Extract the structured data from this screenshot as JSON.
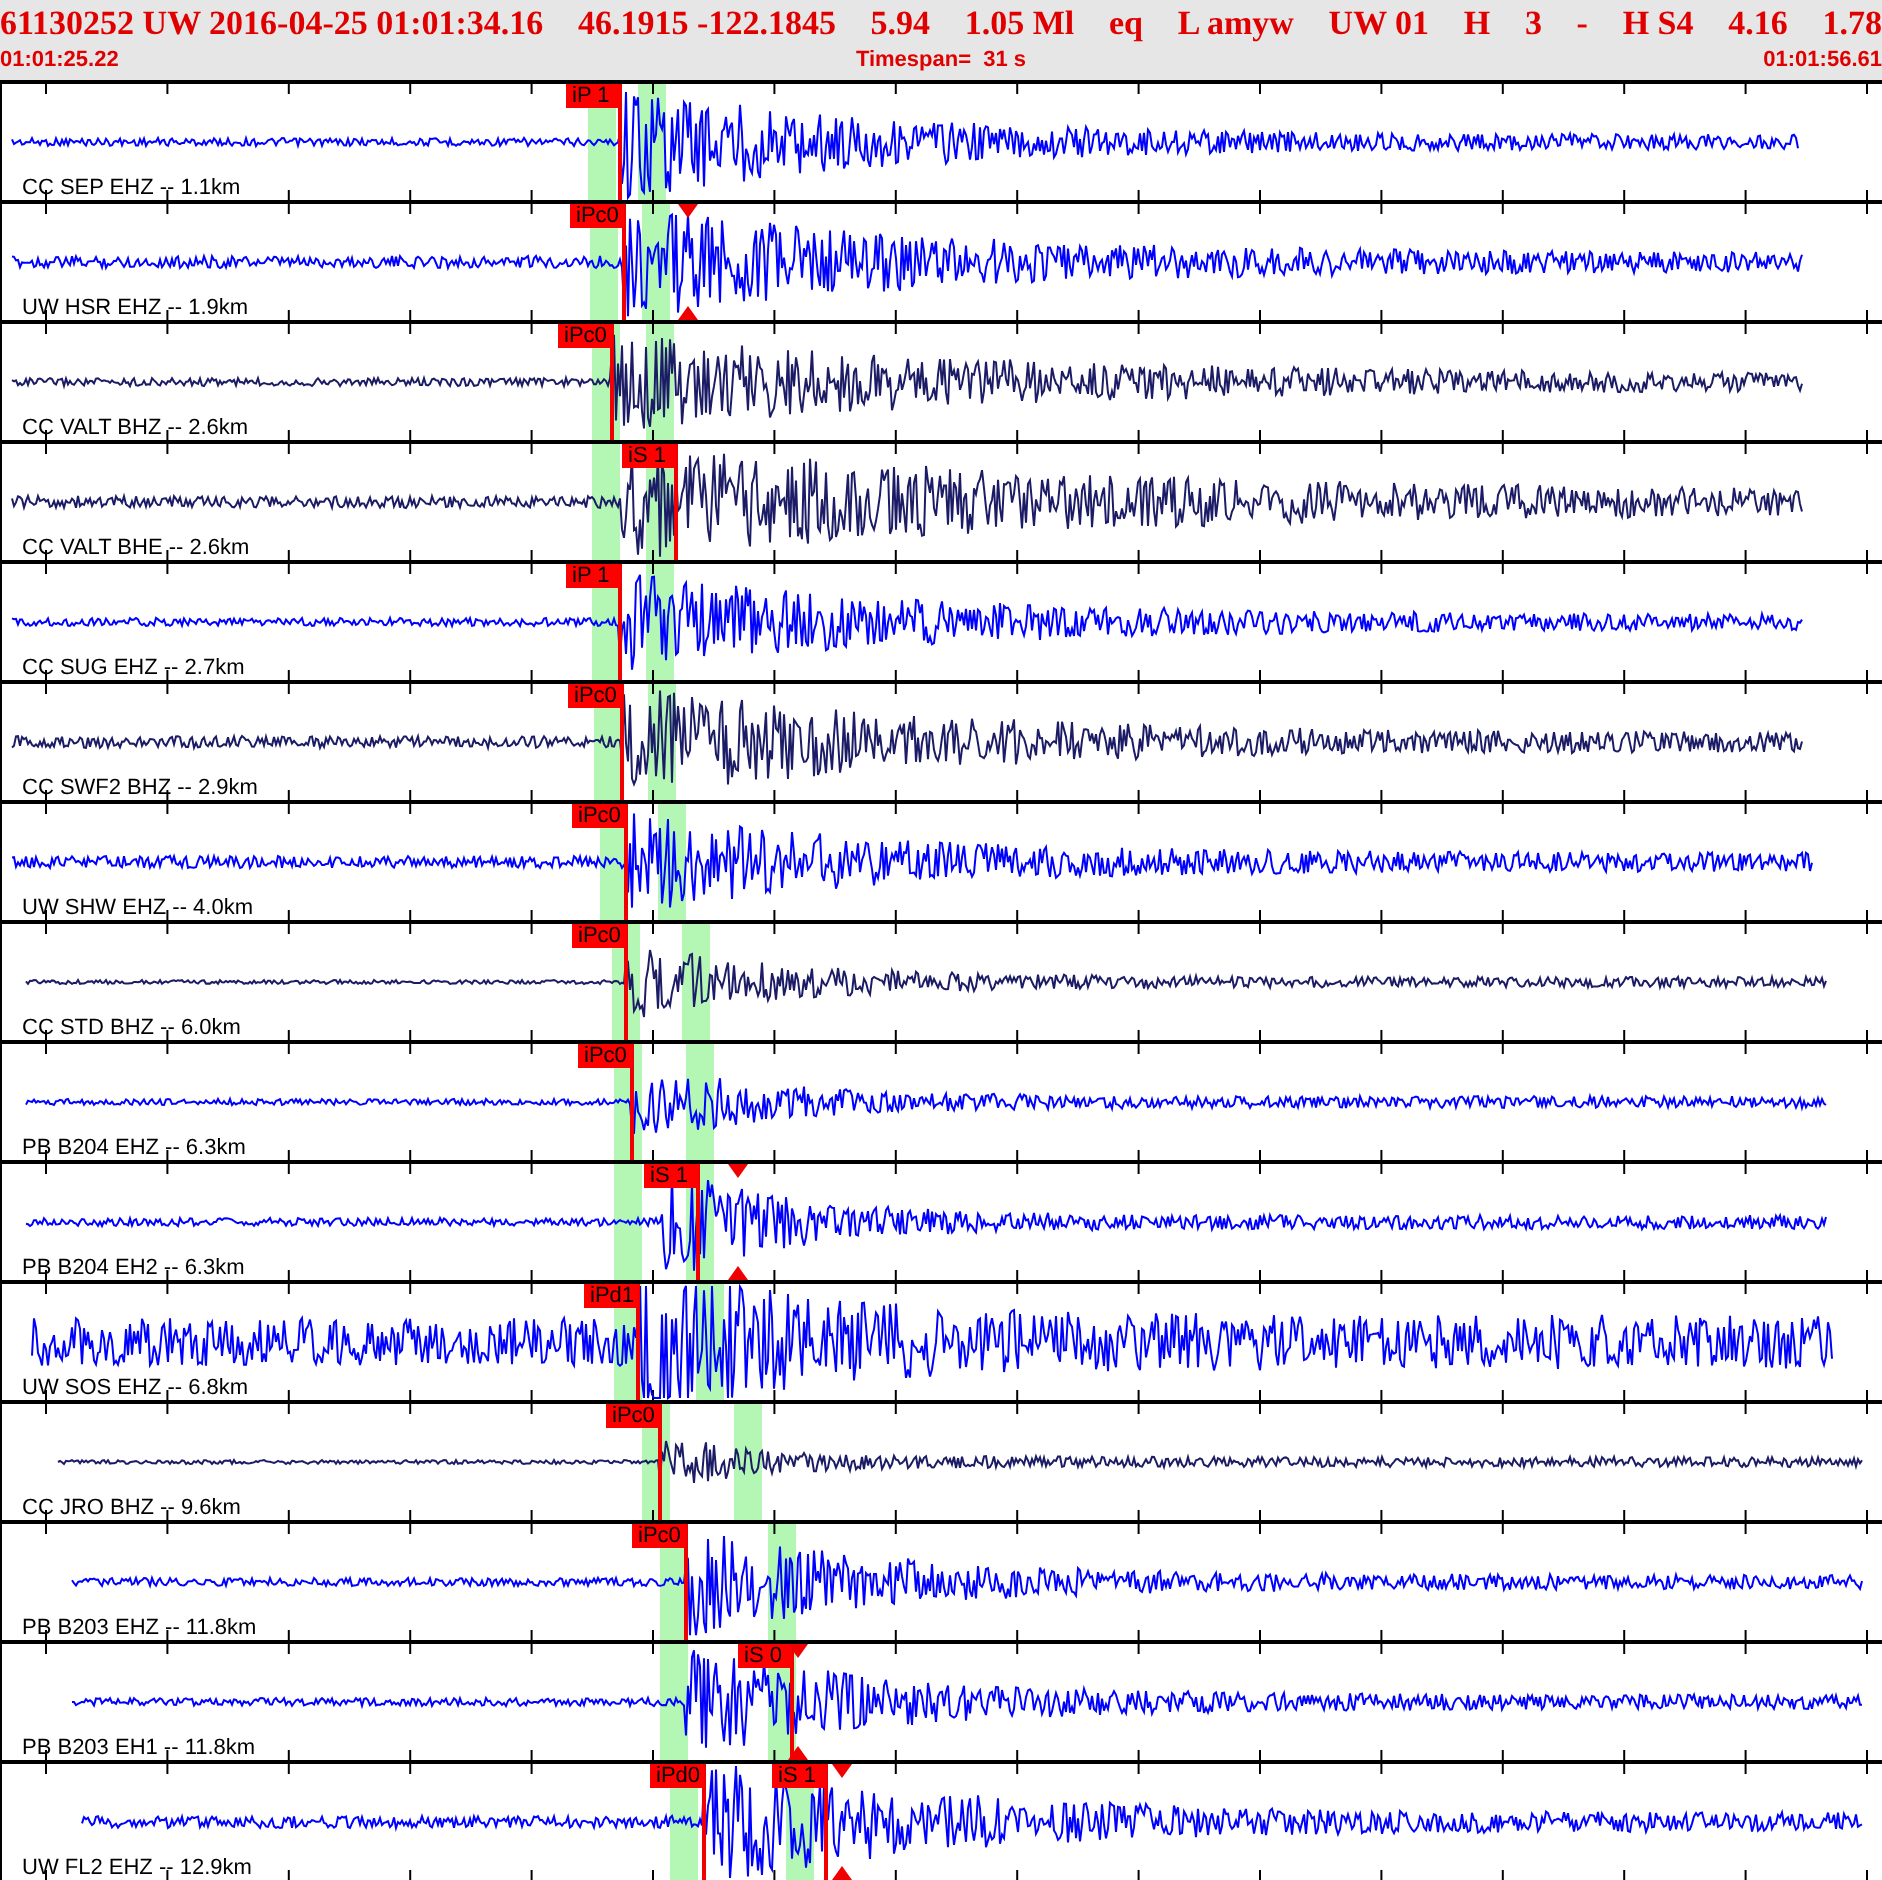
{
  "header": {
    "summary": [
      "61130252 UW 2016-04-25 01:01:34.16",
      "46.1915 -122.1845",
      "5.94",
      "1.05 Ml",
      "eq",
      "L amyw",
      "UW 01",
      "H",
      "3",
      "-",
      "H S4",
      "4.16",
      "1.78"
    ],
    "start_time": "01:01:25.22",
    "timespan": "Timespan=  31 s",
    "end_time": "01:01:56.61"
  },
  "traces": [
    {
      "station": "CC SEP EHZ -- 1.1km",
      "color": "#0000ff",
      "marker": false,
      "picks": [
        {
          "label": "iP 1"
        }
      ]
    },
    {
      "station": "UW HSR EHZ -- 1.9km",
      "color": "#0000ff",
      "marker": true,
      "picks": [
        {
          "label": "iPc0"
        }
      ]
    },
    {
      "station": "CC VALT BHZ -- 2.6km",
      "color": "#1c1c66",
      "marker": false,
      "picks": [
        {
          "label": "iPc0"
        }
      ]
    },
    {
      "station": "CC VALT BHE -- 2.6km",
      "color": "#1c1c66",
      "marker": false,
      "picks": [
        {
          "label": "iS 1"
        }
      ]
    },
    {
      "station": "CC SUG EHZ -- 2.7km",
      "color": "#0000ff",
      "marker": false,
      "picks": [
        {
          "label": "iP 1"
        }
      ]
    },
    {
      "station": "CC SWF2 BHZ -- 2.9km",
      "color": "#1c1c66",
      "marker": false,
      "picks": [
        {
          "label": "iPc0"
        }
      ]
    },
    {
      "station": "UW SHW EHZ -- 4.0km",
      "color": "#0000ff",
      "marker": false,
      "picks": [
        {
          "label": "iPc0"
        }
      ]
    },
    {
      "station": "CC STD BHZ -- 6.0km",
      "color": "#1c1c66",
      "marker": false,
      "picks": [
        {
          "label": "iPc0"
        }
      ]
    },
    {
      "station": "PB B204 EHZ -- 6.3km",
      "color": "#0000ff",
      "marker": false,
      "picks": [
        {
          "label": "iPc0"
        }
      ]
    },
    {
      "station": "PB B204 EH2 -- 6.3km",
      "color": "#0000ff",
      "marker": true,
      "picks": [
        {
          "label": "iS 1"
        }
      ]
    },
    {
      "station": "UW SOS EHZ -- 6.8km",
      "color": "#0000ff",
      "marker": false,
      "picks": [
        {
          "label": "iPd1"
        }
      ]
    },
    {
      "station": "CC JRO BHZ -- 9.6km",
      "color": "#1c1c66",
      "marker": false,
      "picks": [
        {
          "label": "iPc0"
        }
      ]
    },
    {
      "station": "PB B203 EHZ -- 11.8km",
      "color": "#0000ff",
      "marker": false,
      "picks": [
        {
          "label": "iPc0"
        }
      ]
    },
    {
      "station": "PB B203 EH1 -- 11.8km",
      "color": "#0000ff",
      "marker": true,
      "picks": [
        {
          "label": "iS 0"
        }
      ]
    },
    {
      "station": "UW FL2 EHZ -- 12.9km",
      "color": "#0000ff",
      "marker": true,
      "picks": [
        {
          "label": "iPd0"
        },
        {
          "label": "iS 1"
        }
      ]
    }
  ]
}
